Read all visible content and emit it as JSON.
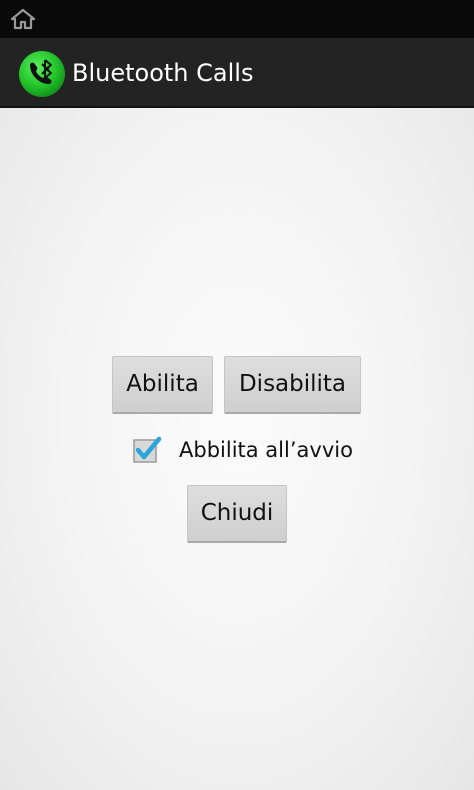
{
  "status_bar": {
    "icon": "home-icon"
  },
  "action_bar": {
    "title": "Bluetooth Calls",
    "app_icon": "bluetooth-phone-icon",
    "app_icon_color": "#22c42a"
  },
  "main": {
    "enable_button": "Abilita",
    "disable_button": "Disabilita",
    "start_on_boot": {
      "label": "Abbilita all’avvio",
      "checked": true,
      "check_color": "#2aa6dd"
    },
    "close_button": "Chiudi"
  }
}
